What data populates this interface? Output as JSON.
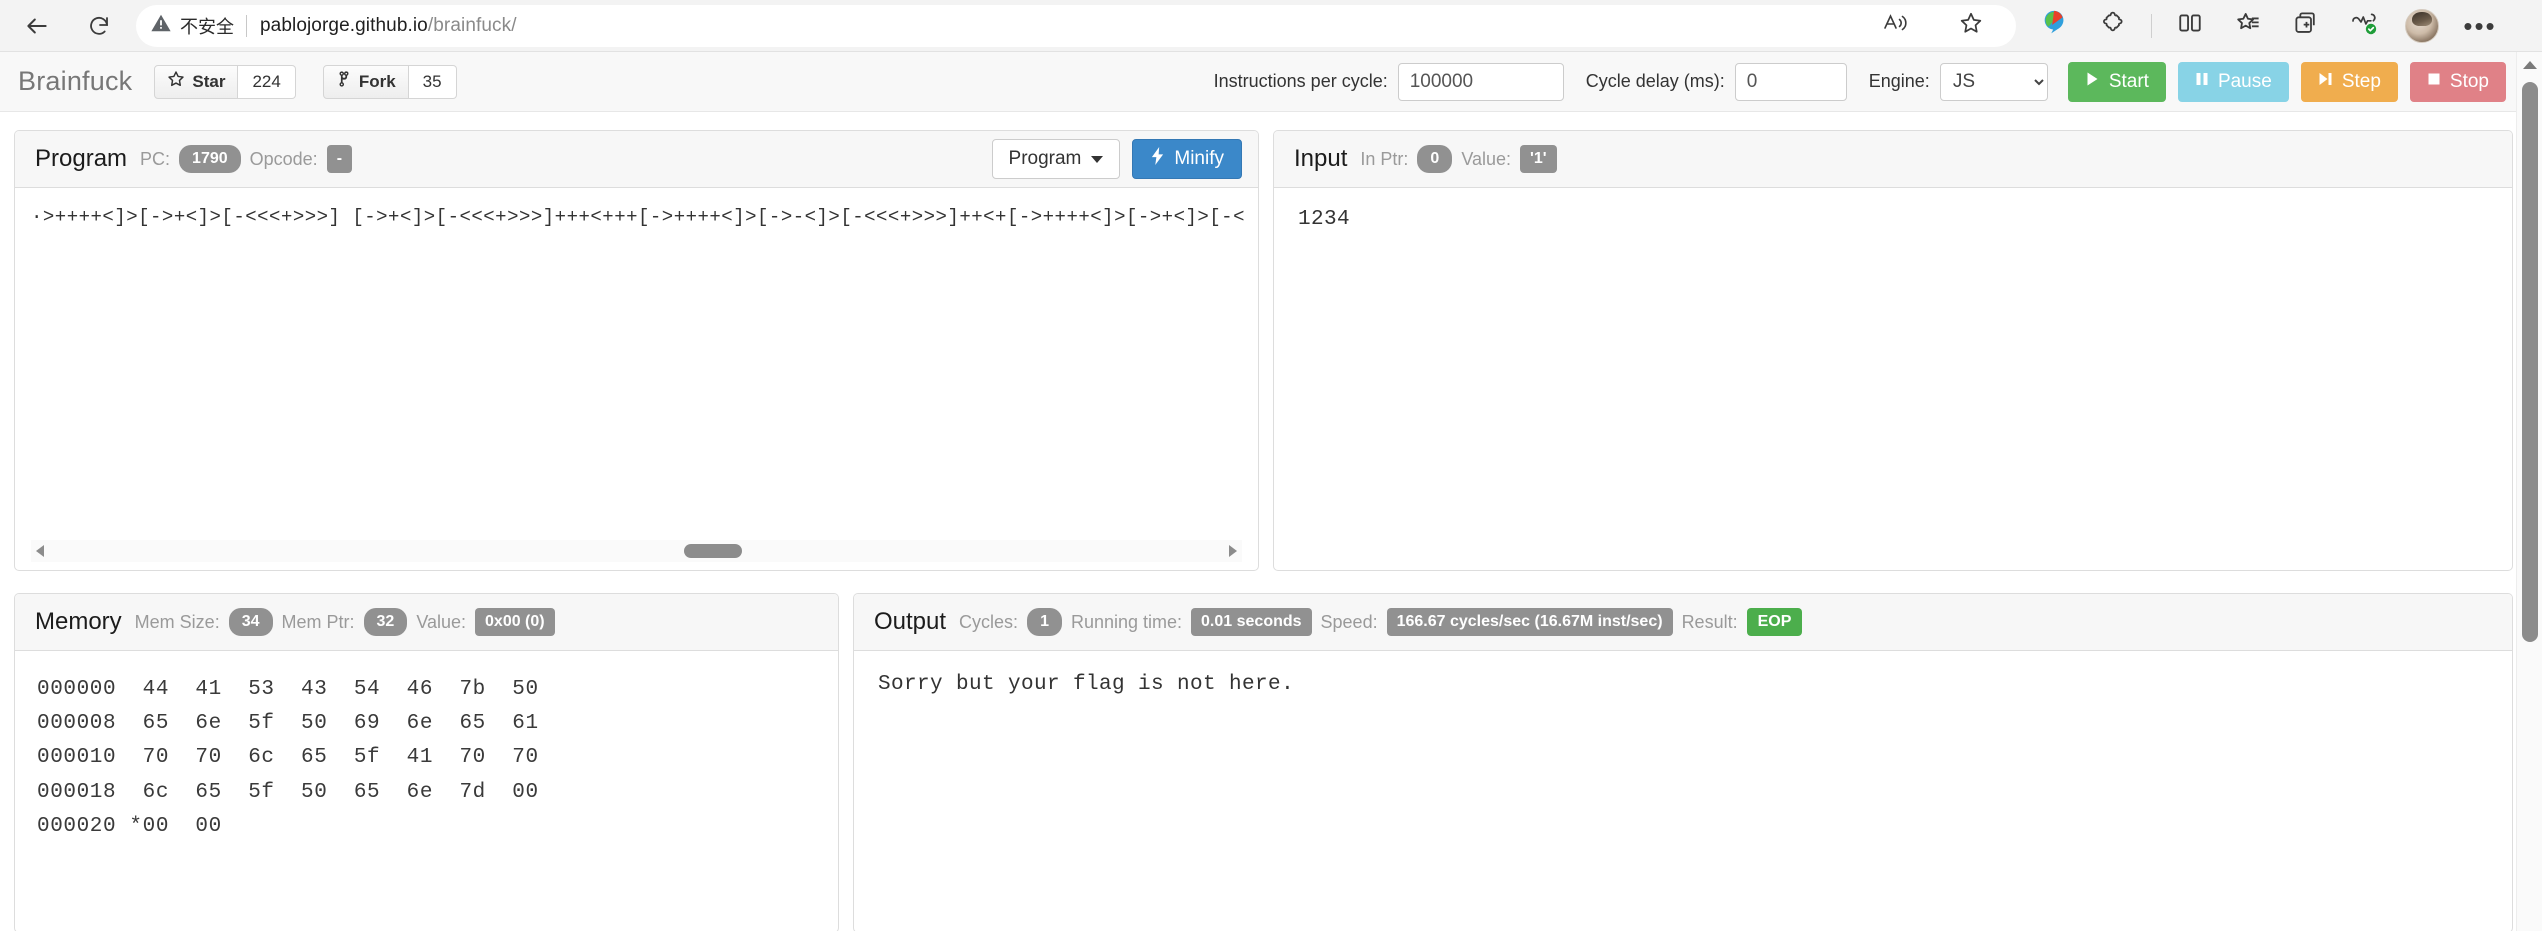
{
  "browser": {
    "back_icon": "back-arrow-icon",
    "reload_icon": "reload-icon",
    "security_label": "不安全",
    "url_host": "pablojorge.github.io",
    "url_path": "/brainfuck/",
    "read_aloud_icon": "read-aloud-icon",
    "favorite_icon": "star-outline-icon",
    "idm_icon": "idm-extension-icon",
    "extensions_icon": "extensions-puzzle-icon",
    "split_screen_icon": "split-screen-icon",
    "collections_icon": "collections-star-icon",
    "add_tab_icon": "add-to-collection-icon",
    "performance_icon": "browser-essentials-icon",
    "profile_icon": "profile-avatar",
    "settings_icon": "settings-more-icon"
  },
  "navbar": {
    "brand": "Brainfuck",
    "github": {
      "star_label": "Star",
      "star_count": "224",
      "fork_label": "Fork",
      "fork_count": "35",
      "star_icon": "star-icon",
      "fork_icon": "fork-icon"
    },
    "instructions_label": "Instructions per cycle:",
    "instructions_value": "100000",
    "cycle_delay_label": "Cycle delay (ms):",
    "cycle_delay_value": "0",
    "engine_label": "Engine:",
    "engine_value": "JS",
    "engine_options": [
      "JS"
    ],
    "controls": {
      "start": "Start",
      "pause": "Pause",
      "step": "Step",
      "stop": "Stop",
      "start_icon": "play-icon",
      "pause_icon": "pause-icon",
      "step_icon": "step-forward-icon",
      "stop_icon": "stop-square-icon"
    },
    "colors": {
      "start": "#5cb85c",
      "pause": "#88d3e6",
      "step": "#f0ad4e",
      "stop": "#e08187"
    }
  },
  "program_panel": {
    "title": "Program",
    "pc_label": "PC:",
    "pc_value": "1790",
    "opcode_label": "Opcode:",
    "opcode_value": "-",
    "dropdown_label": "Program",
    "minify_label": "Minify",
    "minify_icon": "bolt-icon",
    "caret_icon": "caret-down-icon",
    "code": "·>++++<]>[->+<]>[-<<<+>>>] [->+<]>[-<<<+>>>]+++<+++[->++++<]>[->-<]>[-<<<+>>>]++<+[->++++<]>[->+<]>[-<",
    "scrollbar": {
      "left_arrow_icon": "scroll-left-arrow-icon",
      "right_arrow_icon": "scroll-right-arrow-icon"
    }
  },
  "input_panel": {
    "title": "Input",
    "in_ptr_label": "In Ptr:",
    "in_ptr_value": "0",
    "value_label": "Value:",
    "value_value": "'1'",
    "content": "1234"
  },
  "memory_panel": {
    "title": "Memory",
    "mem_size_label": "Mem Size:",
    "mem_size_value": "34",
    "mem_ptr_label": "Mem Ptr:",
    "mem_ptr_value": "32",
    "value_label": "Value:",
    "value_value": "0x00 (0)",
    "dump": "000000  44  41  53  43  54  46  7b  50\n000008  65  6e  5f  50  69  6e  65  61\n000010  70  70  6c  65  5f  41  70  70\n000018  6c  65  5f  50  65  6e  7d  00\n000020 *00  00"
  },
  "output_panel": {
    "title": "Output",
    "cycles_label": "Cycles:",
    "cycles_value": "1",
    "running_time_label": "Running time:",
    "running_time_value": "0.01 seconds",
    "speed_label": "Speed:",
    "speed_value": "166.67 cycles/sec (16.67M inst/sec)",
    "result_label": "Result:",
    "result_value": "EOP",
    "result_color": "#4cae4c",
    "content": "Sorry but your flag is not here."
  }
}
